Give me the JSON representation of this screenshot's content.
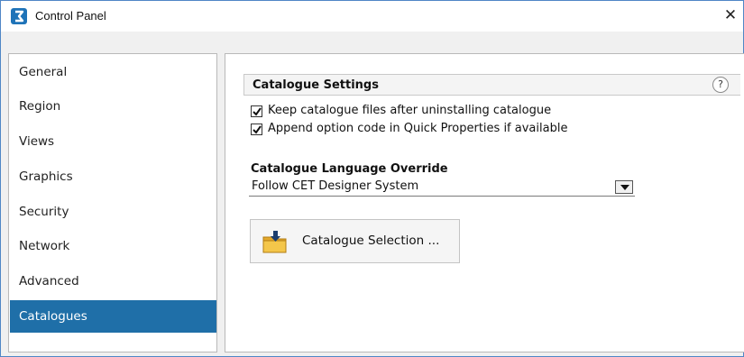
{
  "window": {
    "title": "Control Panel",
    "app_icon": "control-panel-icon",
    "close_symbol": "✕"
  },
  "sidebar": {
    "items": [
      {
        "label": "General",
        "active": false
      },
      {
        "label": "Region",
        "active": false
      },
      {
        "label": "Views",
        "active": false
      },
      {
        "label": "Graphics",
        "active": false
      },
      {
        "label": "Security",
        "active": false
      },
      {
        "label": "Network",
        "active": false
      },
      {
        "label": "Advanced",
        "active": false
      },
      {
        "label": "Catalogues",
        "active": true
      }
    ]
  },
  "catalogue_settings": {
    "title": "Catalogue Settings",
    "help_symbol": "?",
    "options": [
      {
        "label": "Keep catalogue files after uninstalling catalogue",
        "checked": true
      },
      {
        "label": "Append option code in Quick Properties if available",
        "checked": true
      }
    ]
  },
  "language_override": {
    "label": "Catalogue Language Override",
    "selected": "Follow CET Designer System"
  },
  "catalogue_selection_button": {
    "label": "Catalogue Selection ...",
    "icon": "folder-download-icon"
  },
  "colors": {
    "accent": "#1f6fa8",
    "window_border": "#4f86c6"
  }
}
